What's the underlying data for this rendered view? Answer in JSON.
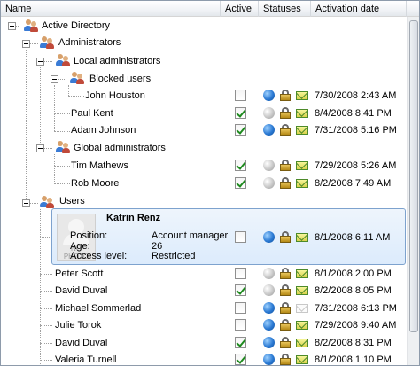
{
  "header": {
    "name": "Name",
    "active": "Active",
    "statuses": "Statuses",
    "activation_date": "Activation date"
  },
  "tree": {
    "root": "Active Directory",
    "administrators": "Administrators",
    "local_admins": "Local administrators",
    "blocked_users": "Blocked users",
    "global_admins": "Global administrators",
    "users": "Users"
  },
  "rows": [
    {
      "name": "John Houston",
      "active": false,
      "online": true,
      "mail": true,
      "date": "7/30/2008 2:43 AM"
    },
    {
      "name": "Paul Kent",
      "active": true,
      "online": false,
      "mail": true,
      "date": "8/4/2008 8:41 PM"
    },
    {
      "name": "Adam Johnson",
      "active": true,
      "online": true,
      "mail": true,
      "date": "7/31/2008 5:16 PM"
    },
    {
      "name": "Tim Mathews",
      "active": true,
      "online": false,
      "mail": true,
      "date": "7/29/2008 5:26 AM"
    },
    {
      "name": "Rob Moore",
      "active": true,
      "online": false,
      "mail": true,
      "date": "8/2/2008 7:49 AM"
    },
    {
      "name": "Peter Scott",
      "active": false,
      "online": false,
      "mail": true,
      "date": "8/1/2008 2:00 PM"
    },
    {
      "name": "David Duval",
      "active": true,
      "online": false,
      "mail": true,
      "date": "8/2/2008 8:05 PM"
    },
    {
      "name": "Michael Sommerlad",
      "active": false,
      "online": true,
      "mail": false,
      "date": "7/31/2008 6:13 PM"
    },
    {
      "name": "Julie Torok",
      "active": false,
      "online": true,
      "mail": true,
      "date": "7/29/2008 9:40 AM"
    },
    {
      "name": "David Duval",
      "active": true,
      "online": true,
      "mail": true,
      "date": "8/2/2008 8:31 PM"
    },
    {
      "name": "Valeria Turnell",
      "active": true,
      "online": true,
      "mail": true,
      "date": "8/1/2008 1:10 PM"
    }
  ],
  "selected": {
    "name": "Katrin Renz",
    "position_label": "Position:",
    "position": "Account manager",
    "age_label": "Age:",
    "age": "26",
    "access_label": "Access level:",
    "access": "Restricted",
    "no_photo_1": "NO",
    "no_photo_2": "PHOTO",
    "active": false,
    "online": true,
    "mail": true,
    "date": "8/1/2008 6:11 AM"
  },
  "colors": {
    "group_head": "#d7a06a",
    "group_body": "#3a7bd5",
    "selection_border": "#7da2ce"
  }
}
